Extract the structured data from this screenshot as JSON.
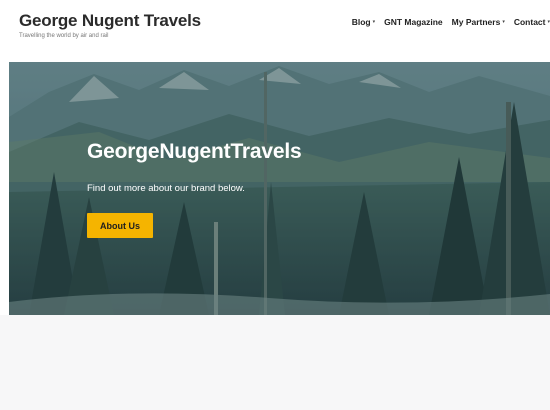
{
  "site": {
    "title": "George Nugent Travels",
    "tagline": "Travelling the world by air and rail"
  },
  "nav": {
    "items": [
      {
        "label": "Blog",
        "has_dropdown": true
      },
      {
        "label": "GNT Magazine",
        "has_dropdown": false
      },
      {
        "label": "My Partners",
        "has_dropdown": true
      },
      {
        "label": "Contact",
        "has_dropdown": true
      }
    ],
    "caret_glyph": "▾"
  },
  "hero": {
    "title": "GeorgeNugentTravels",
    "subtitle": "Find out more about our brand below.",
    "button_label": "About Us",
    "button_color": "#f5b400",
    "overlay_color": "#2f4f57"
  }
}
